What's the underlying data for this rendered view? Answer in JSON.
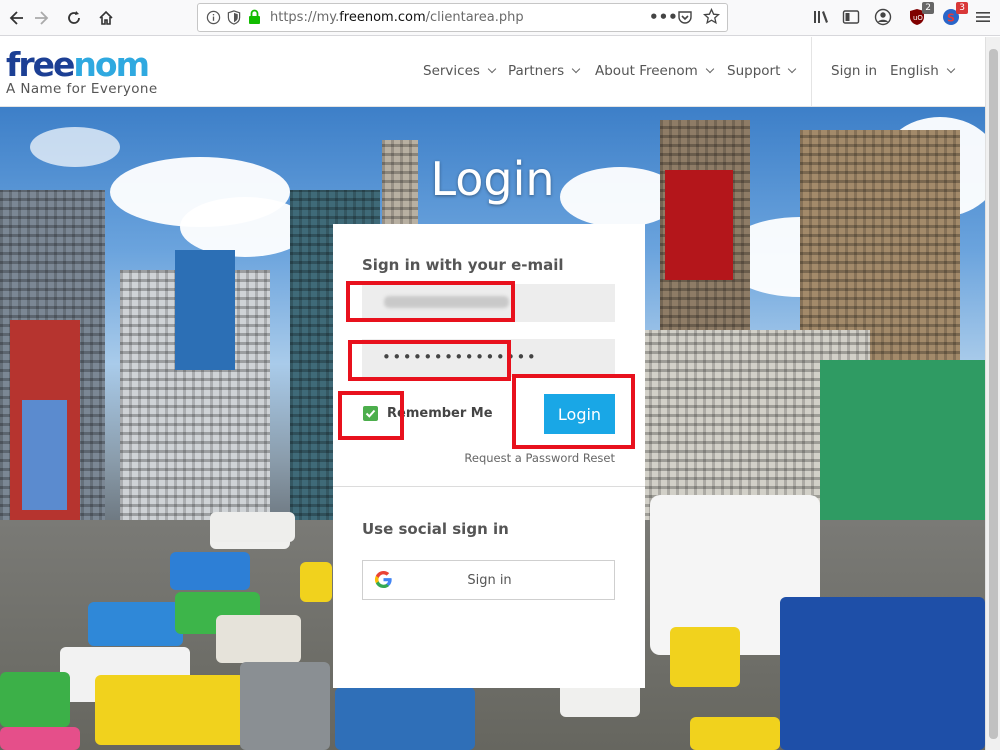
{
  "browser": {
    "url_prefix": "https://my.",
    "url_host": "freenom.com",
    "url_path": "/clientarea.php",
    "badges": {
      "ublock": "2",
      "extension": "3"
    }
  },
  "header": {
    "logo_free": "free",
    "logo_nom": "nom",
    "tagline": "A Name for Everyone",
    "menu": [
      {
        "label": "Services"
      },
      {
        "label": "Partners"
      },
      {
        "label": "About Freenom"
      },
      {
        "label": "Support"
      }
    ],
    "sign_in": "Sign in",
    "language": "English"
  },
  "hero": {
    "title": "Login"
  },
  "login_card": {
    "email_heading": "Sign in with your e-mail",
    "password_masked": "•••••••••••••••",
    "remember_label": "Remember Me",
    "remember_checked": true,
    "login_button": "Login",
    "reset_link": "Request a Password Reset",
    "social_heading": "Use social sign in",
    "google_button": "Sign in"
  },
  "colors": {
    "accent": "#19a7e6",
    "logo_dark": "#1c3f94",
    "logo_light": "#2fa9e0",
    "highlight": "#e8111d",
    "checkbox": "#4cae4c"
  }
}
